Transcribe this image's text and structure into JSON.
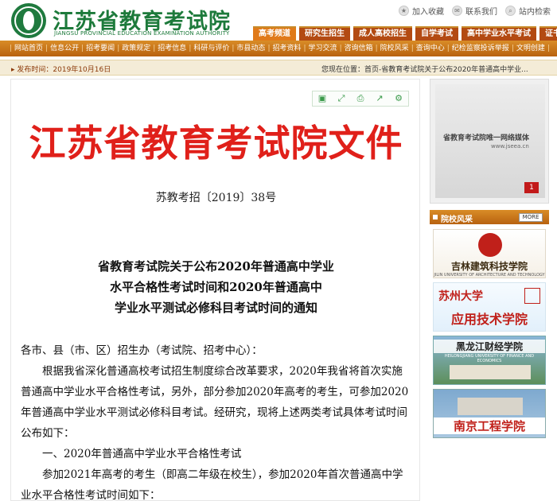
{
  "header": {
    "logo_cn": "江苏省教育考试院",
    "logo_en": "JIANGSU PROVINCIAL EDUCATION EXAMINATION AUTHORITY",
    "top_links": [
      "加入收藏",
      "联系我们",
      "站内检索"
    ],
    "tabs": [
      "高考频道",
      "研究生招生",
      "成人高校招生",
      "自学考试",
      "高中学业水平考试",
      "证书考试"
    ]
  },
  "nav": {
    "items": [
      "网站首页",
      "信息公开",
      "招考要闻",
      "政策规定",
      "招考信息",
      "科研与评价",
      "市县动态",
      "招考资料",
      "学习交流",
      "咨询信箱",
      "院校风采",
      "查询中心",
      "纪检监察投诉举报",
      "文明创建"
    ]
  },
  "infobar": {
    "publish_date": "发布时间：2019年10月16日",
    "breadcrumb": "您现在位置：首页-省教育考试院关于公布2020年普通高中学业..."
  },
  "article": {
    "tool_icons": [
      "doc-icon",
      "fullscreen-icon",
      "print-icon",
      "share-icon",
      "settings-icon"
    ],
    "doc_title": "江苏省教育考试院文件",
    "doc_number": "苏教考招〔2019〕38号",
    "notice_title_lines": [
      "省教育考试院关于公布2020年普通高中学业",
      "水平合格性考试时间和2020年普通高中",
      "学业水平测试必修科目考试时间的通知"
    ],
    "body": {
      "salutation": "各市、县（市、区）招生办（考试院、招考中心）：",
      "para1": "根据我省深化普通高校考试招生制度综合改革要求，2020年我省将首次实施普通高中学业水平合格性考试，另外，部分参加2020年高考的考生，可参加2020年普通高中学业水平测试必修科目考试。经研究，现将上述两类考试具体考试时间公布如下：",
      "section1": "一、2020年普通高中学业水平合格性考试",
      "para2": "参加2021年高考的考生（即高二年级在校生），参加2020年首次普通高中学业水平合格性考试时间如下："
    }
  },
  "sidebar": {
    "banner_text": "省教育考试院唯一网络媒体",
    "banner_sub": "www.jseea.cn",
    "banner_page": "1",
    "section_title": "院校风采",
    "more_label": "MORE",
    "campus": [
      {
        "name": "吉林建筑科技学院",
        "en": "JILIN UNIVERSITY OF ARCHITECTURE AND TECHNOLOGY"
      },
      {
        "brush": "苏州大学",
        "name": "应用技术学院"
      },
      {
        "name": "黑龙江财经学院",
        "en": "HEILONGJIANG UNIVERSITY OF FINANCE AND ECONOMICS"
      },
      {
        "name": "南京工程学院"
      }
    ]
  }
}
